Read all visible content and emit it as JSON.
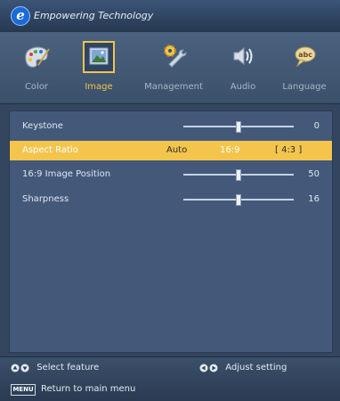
{
  "brand": {
    "logo_letter": "e",
    "title": "Empowering Technology"
  },
  "tabs": [
    {
      "label": "Color",
      "icon": "palette-icon",
      "active": false
    },
    {
      "label": "Image",
      "icon": "picture-icon",
      "active": true
    },
    {
      "label": "Management",
      "icon": "wrench-gear-icon",
      "active": false
    },
    {
      "label": "Audio",
      "icon": "speaker-icon",
      "active": false
    },
    {
      "label": "Language",
      "icon": "speech-bubble-abc-icon",
      "active": false
    }
  ],
  "settings": {
    "keystone": {
      "label": "Keystone",
      "value": "0",
      "level": 0.5
    },
    "aspect_ratio": {
      "label": "Aspect Ratio",
      "options": [
        "Auto",
        "16:9",
        "[ 4:3 ]"
      ],
      "selected": "4:3"
    },
    "image_position": {
      "label": "16:9 Image Position",
      "value": "50",
      "level": 0.5
    },
    "sharpness": {
      "label": "Sharpness",
      "value": "16",
      "level": 0.5
    }
  },
  "footer": {
    "select_feature": "Select feature",
    "adjust_setting": "Adjust setting",
    "menu_key": "MENU",
    "return_menu": "Return to main menu"
  },
  "colors": {
    "highlight": "#f3c54d",
    "active_tab": "#f2c44b",
    "panel": "#44597a"
  }
}
